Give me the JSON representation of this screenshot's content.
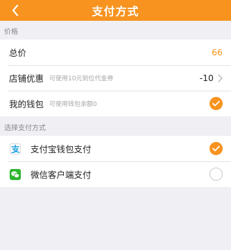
{
  "header": {
    "title": "支付方式"
  },
  "price_section": {
    "label": "价格",
    "total": {
      "label": "总价",
      "value": "66"
    },
    "shop_discount": {
      "label": "店铺优惠",
      "hint": "可使用10元到位代金券",
      "value": "-10"
    },
    "wallet": {
      "label": "我的钱包",
      "hint": "可使用钱包余额0",
      "checked": true
    }
  },
  "payment_section": {
    "label": "选择支付方式",
    "methods": [
      {
        "label": "支付宝钱包支付",
        "icon": "alipay-icon",
        "checked": true
      },
      {
        "label": "微信客户端支付",
        "icon": "wechat-icon",
        "checked": false
      }
    ]
  },
  "colors": {
    "accent": "#f7931e",
    "background": "#efeff4"
  }
}
